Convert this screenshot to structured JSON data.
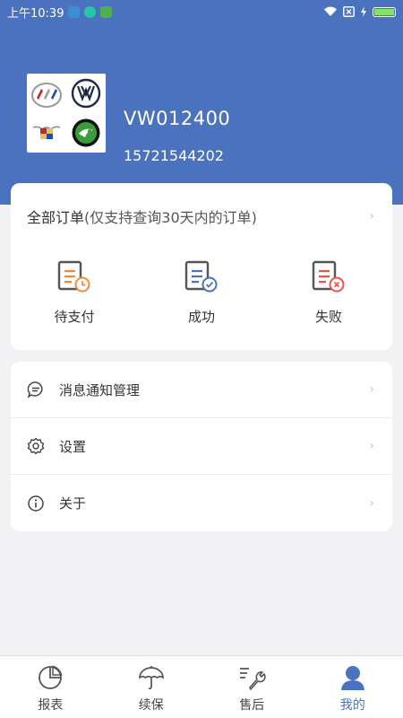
{
  "status_bar": {
    "time": "上午10:39",
    "battery_color": "#7ee66e"
  },
  "account": {
    "name": "VW012400",
    "phone": "15721544202",
    "brands": [
      "buick-logo",
      "volkswagen-logo",
      "cadillac-logo",
      "skoda-logo"
    ]
  },
  "orders": {
    "title": "全部订单",
    "note": "(仅支持查询30天内的订单)",
    "statuses": [
      {
        "label": "待支付",
        "icon": "pending-payment-icon"
      },
      {
        "label": "成功",
        "icon": "success-order-icon"
      },
      {
        "label": "失败",
        "icon": "failed-order-icon"
      }
    ]
  },
  "menu": [
    {
      "label": "消息通知管理",
      "icon": "message-icon"
    },
    {
      "label": "设置",
      "icon": "gear-icon"
    },
    {
      "label": "关于",
      "icon": "info-icon"
    }
  ],
  "nav": [
    {
      "label": "报表",
      "icon": "pie-chart-icon",
      "active": false
    },
    {
      "label": "续保",
      "icon": "umbrella-icon",
      "active": false
    },
    {
      "label": "售后",
      "icon": "wrench-icon",
      "active": false
    },
    {
      "label": "我的",
      "icon": "user-icon",
      "active": true
    }
  ],
  "colors": {
    "header": "#4a72bf",
    "accent": "#4a72bf",
    "icon_orange": "#f08a3c",
    "icon_red": "#e8574f",
    "icon_dark": "#555555"
  }
}
